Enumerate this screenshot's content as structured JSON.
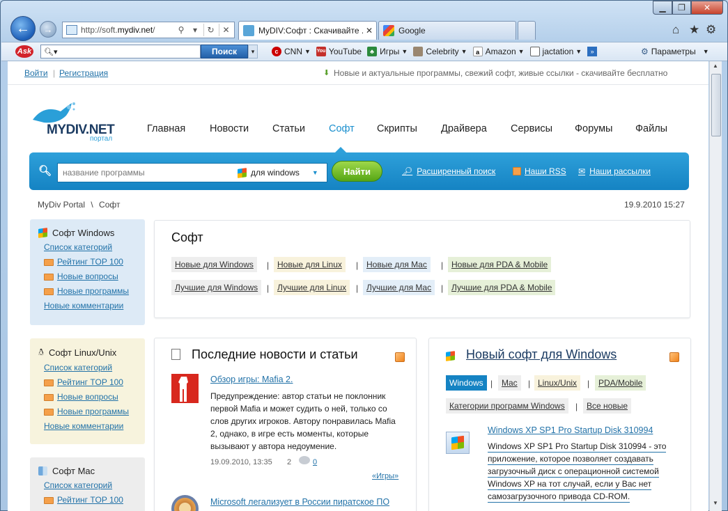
{
  "browser": {
    "address_url": "http://soft.mydiv.net/",
    "address_url_prefix": "http://soft.",
    "address_url_host": "mydiv.net",
    "address_url_suffix": "/",
    "tabs": [
      {
        "label": "MyDIV:Софт : Скачивайте ..."
      },
      {
        "label": "Google"
      }
    ],
    "search_button": "Поиск",
    "bookmarks": [
      "CNN",
      "YouTube",
      "Игры",
      "Celebrity",
      "Amazon",
      "jactation"
    ],
    "options_label": "Параметры"
  },
  "site": {
    "login": "Войти",
    "register": "Регистрация",
    "tagline": "Новые и актуальные программы, свежий софт, живые ссылки - скачивайте бесплатно",
    "logo_text": "MYDIV.NET",
    "logo_sub": "портал",
    "menu": [
      "Главная",
      "Новости",
      "Статьи",
      "Софт",
      "Скрипты",
      "Драйвера",
      "Сервисы",
      "Форумы",
      "Файлы"
    ],
    "active_menu": "Софт",
    "search": {
      "placeholder": "название программы",
      "platform": "для windows",
      "button": "Найти",
      "advanced": "Расширенный поиск",
      "rss": "Наши RSS",
      "newsletter": "Наши рассылки"
    },
    "breadcrumb": [
      "MyDiv Portal",
      "Софт"
    ],
    "datetime": "19.9.2010 15:27"
  },
  "sidebar": [
    {
      "title": "Софт Windows",
      "links": [
        "Список категорий",
        "Рейтинг TOP 100",
        "Новые вопросы",
        "Новые программы",
        "Новые комментарии"
      ]
    },
    {
      "title": "Софт Linux/Unix",
      "links": [
        "Список категорий",
        "Рейтинг TOP 100",
        "Новые вопросы",
        "Новые программы",
        "Новые комментарии"
      ]
    },
    {
      "title": "Софт Mac",
      "links": [
        "Список категорий",
        "Рейтинг TOP 100"
      ]
    }
  ],
  "soft_box": {
    "title": "Софт",
    "row1": [
      "Новые для Windows",
      "Новые для Linux",
      "Новые для Mac",
      "Новые для PDA & Mobile"
    ],
    "row2": [
      "Лучшие для Windows",
      "Лучшие для Linux",
      "Лучшие для Mac",
      "Лучшие для PDA & Mobile"
    ]
  },
  "news": {
    "title": "Последние новости и статьи",
    "item1": {
      "title": "Обзор игры: Mafia 2.",
      "text1": "Предупреждение: автор статьи не поклонник",
      "text2": "первой Mafia и может судить о ней, только со",
      "text3": "слов других игроков. Автору понравилась Mafia",
      "text4": "2, однако, в игре есть моменты, которые",
      "text5": "вызывают у автора недоумение.",
      "date": "19.09.2010, 13:35",
      "views": "2",
      "comments": "0",
      "category": "«Игры»"
    },
    "item2_title": "Microsoft легализует в России пиратское ПО"
  },
  "new_soft": {
    "title": "Новый софт для Windows",
    "tabs": [
      "Windows",
      "Mac",
      "Linux/Unix",
      "PDA/Mobile"
    ],
    "active_tab": "Windows",
    "sub": [
      "Категории программ Windows",
      "Все новые"
    ],
    "item_title": "Windows XP SP1 Pro Startup Disk 310994",
    "item_text1": "Windows XP SP1 Pro Startup Disk 310994 - это",
    "item_text2": "приложение, которое позволяет создавать",
    "item_text3": "загрузочный диск с операционной системой",
    "item_text4": "Windows XP на тот случай, если у Вас нет",
    "item_text5": "самозагрузочного привода CD-ROM."
  },
  "colors": {
    "accent_blue": "#1a8fce",
    "link": "#2272a8",
    "green_button": "#6cbf22",
    "chip_grey": "#eeeeee",
    "chip_yellow": "#f8f2dc",
    "chip_blue": "#e3eef8",
    "chip_green": "#e6f0d8",
    "sidebar_blue": "#ddeaf6",
    "sidebar_yellow": "#f7f3dd",
    "sidebar_grey": "#ededed"
  }
}
